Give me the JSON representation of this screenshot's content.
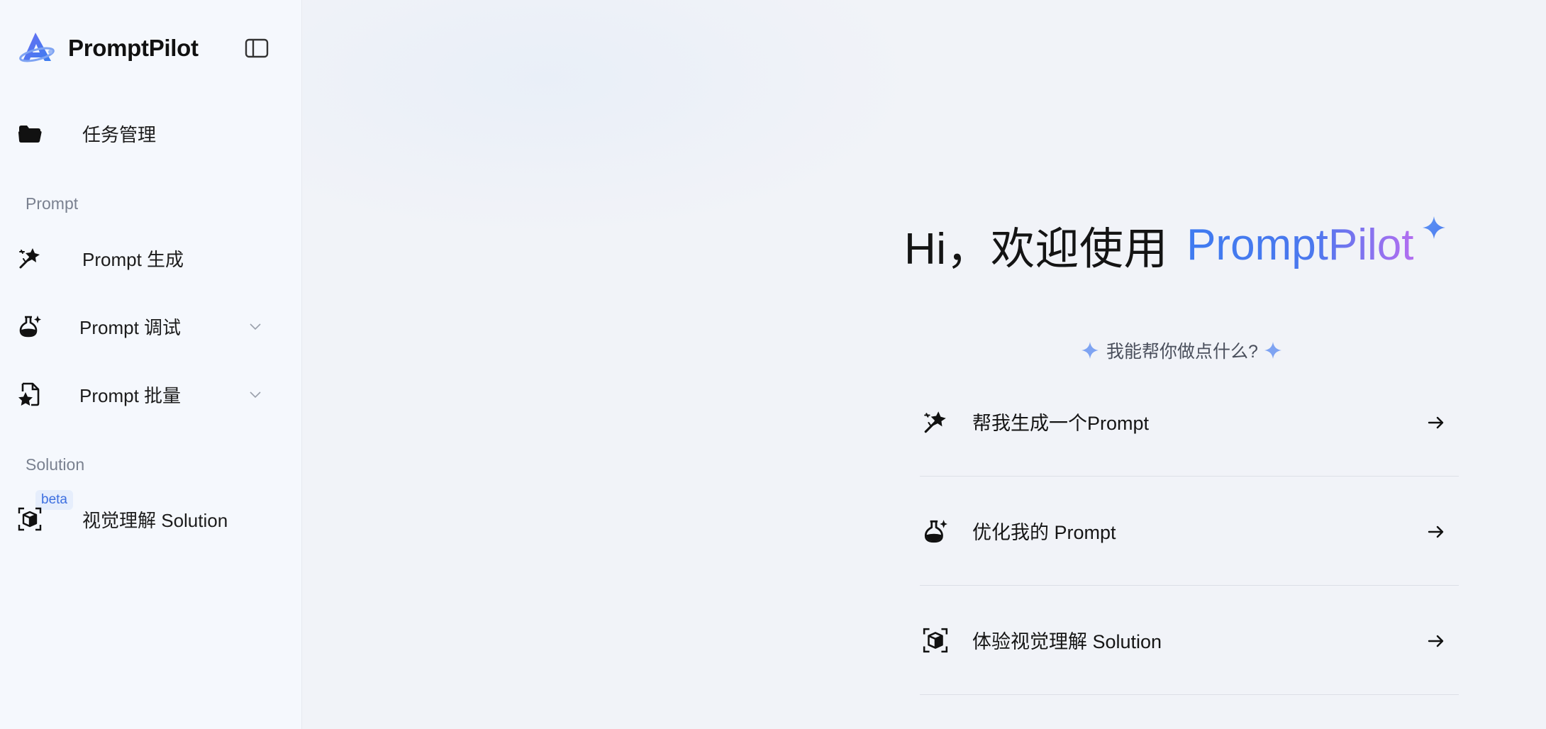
{
  "app": {
    "name": "PromptPilot"
  },
  "sidebar": {
    "collapse_icon": "sidebar-collapse-icon",
    "task_item": {
      "label": "任务管理",
      "icon": "folder-icon"
    },
    "sections": [
      {
        "title": "Prompt",
        "items": [
          {
            "label": "Prompt 生成",
            "icon": "magic-wand-icon",
            "expandable": false
          },
          {
            "label": "Prompt 调试",
            "icon": "flask-sparkle-icon",
            "expandable": true
          },
          {
            "label": "Prompt 批量",
            "icon": "file-star-icon",
            "expandable": true
          }
        ]
      },
      {
        "title": "Solution",
        "items": [
          {
            "label": "视觉理解 Solution",
            "icon": "cube-scan-icon",
            "badge": "beta"
          }
        ]
      }
    ]
  },
  "main": {
    "greeting": "Hi，欢迎使用",
    "brand": "PromptPilot",
    "subtitle": "我能帮你做点什么?",
    "actions": [
      {
        "label": "帮我生成一个Prompt",
        "icon": "magic-wand-icon"
      },
      {
        "label": "优化我的 Prompt",
        "icon": "flask-sparkle-icon"
      },
      {
        "label": "体验视觉理解 Solution",
        "icon": "cube-scan-icon"
      }
    ]
  },
  "colors": {
    "accent_blue": "#3f7bf0",
    "accent_purple": "#b46ef0",
    "sidebar_bg": "#f5f8fd",
    "main_bg": "#f1f3f8",
    "beta_bg": "#e6eefc",
    "beta_text": "#3d6fe0",
    "sparkle": "#7ea3f2"
  }
}
